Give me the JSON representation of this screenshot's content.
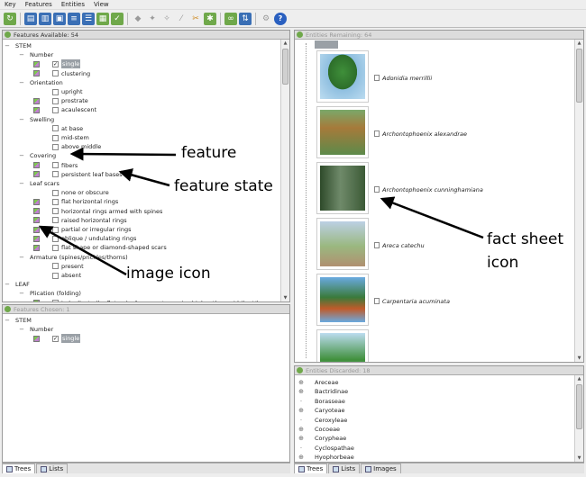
{
  "menu": [
    "Key",
    "Features",
    "Entities",
    "View"
  ],
  "features_available": {
    "title": "Features Available: 54",
    "rows": [
      {
        "label": "STEM",
        "level": 0,
        "expand": "−"
      },
      {
        "label": "Number",
        "level": 1,
        "expand": "−"
      },
      {
        "label": "single",
        "level": 2,
        "img": true,
        "checked": true,
        "selected": true
      },
      {
        "label": "clustering",
        "level": 2,
        "img": true
      },
      {
        "label": "Orientation",
        "level": 1,
        "expand": "−"
      },
      {
        "label": "upright",
        "level": 2
      },
      {
        "label": "prostrate",
        "level": 2,
        "img": true
      },
      {
        "label": "acaulescent",
        "level": 2,
        "img": true
      },
      {
        "label": "Swelling",
        "level": 1,
        "expand": "−"
      },
      {
        "label": "at base",
        "level": 2
      },
      {
        "label": "mid-stem",
        "level": 2
      },
      {
        "label": "above middle",
        "level": 2
      },
      {
        "label": "Covering",
        "level": 1,
        "expand": "−"
      },
      {
        "label": "fibers",
        "level": 2,
        "img": true
      },
      {
        "label": "persistent leaf bases",
        "level": 2,
        "img": true
      },
      {
        "label": "Leaf scars",
        "level": 1,
        "expand": "−"
      },
      {
        "label": "none or obscure",
        "level": 2
      },
      {
        "label": "flat horizontal rings",
        "level": 2,
        "img": true
      },
      {
        "label": "horizontal rings armed with spines",
        "level": 2,
        "img": true
      },
      {
        "label": "raised horizontal rings",
        "level": 2,
        "img": true
      },
      {
        "label": "partial or irregular rings",
        "level": 2,
        "img": true
      },
      {
        "label": "oblique / undulating rings",
        "level": 2,
        "img": true
      },
      {
        "label": "flat shape or diamond-shaped scars",
        "level": 2,
        "img": true
      },
      {
        "label": "Armature (spines/prickles/thorns)",
        "level": 1,
        "expand": "−"
      },
      {
        "label": "present",
        "level": 2
      },
      {
        "label": "absent",
        "level": 2
      },
      {
        "label": "LEAF",
        "level": 0,
        "expand": "−"
      },
      {
        "label": "Plication (folding)",
        "level": 1,
        "expand": "−"
      },
      {
        "label": "induplicate (leaflet or leaf segment margins higher than midrib - V)",
        "level": 2,
        "img": true
      }
    ]
  },
  "features_chosen": {
    "title": "Features Chosen: 1",
    "rows": [
      {
        "label": "STEM",
        "level": 0,
        "expand": "−"
      },
      {
        "label": "Number",
        "level": 1,
        "expand": "−"
      },
      {
        "label": "single",
        "level": 2,
        "img": true,
        "checked": true,
        "selected": true
      }
    ]
  },
  "left_tabs": [
    "Trees",
    "Lists"
  ],
  "entities_remaining": {
    "title": "Entities Remaining: 64",
    "items": [
      {
        "name": "Adonidia merrillii",
        "photo": "palm-crown"
      },
      {
        "name": "Archontophoenix alexandrae",
        "photo": "crownshaft"
      },
      {
        "name": "Archontophoenix cunninghamiana",
        "photo": "trunk"
      },
      {
        "name": "Areca catechu",
        "photo": "palm-tall"
      },
      {
        "name": "Carpentaria acuminata",
        "photo": "palm-fruit"
      },
      {
        "name": "",
        "photo": "palm-top"
      }
    ]
  },
  "entities_discarded": {
    "title": "Entities Discarded: 18",
    "items": [
      {
        "name": "Areceae",
        "expand": true
      },
      {
        "name": "Bactridinae",
        "expand": true
      },
      {
        "name": "Borasseae",
        "expand": false
      },
      {
        "name": "Caryoteae",
        "expand": true
      },
      {
        "name": "Ceroxyleae",
        "expand": false
      },
      {
        "name": "Cocoeae",
        "expand": true
      },
      {
        "name": "Corypheae",
        "expand": true
      },
      {
        "name": "Cyclospathae",
        "expand": false
      },
      {
        "name": "Hyophorbeae",
        "expand": true
      }
    ]
  },
  "right_tabs": [
    "Trees",
    "Lists",
    "Images"
  ],
  "annotations": {
    "feature": "feature",
    "feature_state": "feature state",
    "image_icon": "image icon",
    "fact_sheet_line1": "fact sheet",
    "fact_sheet_line2": "icon"
  },
  "colors": {
    "accent_green": "#6fa84a",
    "selection": "#9aa0a6"
  }
}
